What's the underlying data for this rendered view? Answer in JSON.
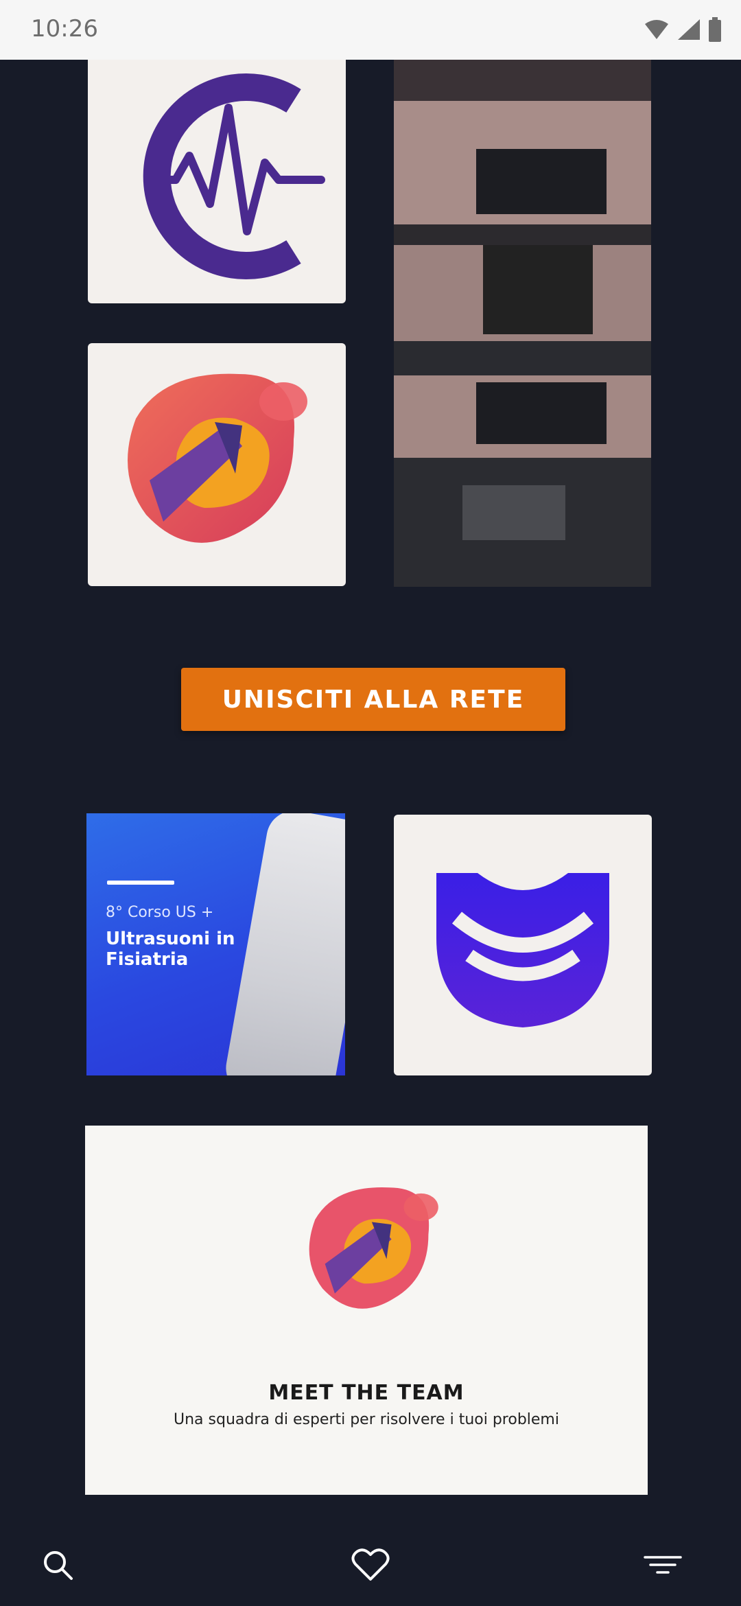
{
  "status_bar": {
    "time": "10:26",
    "icons": [
      "wifi-icon",
      "cellular-signal-icon",
      "battery-icon"
    ]
  },
  "tiles": {
    "logo_c": {
      "icon": "c-heartbeat-logo-icon"
    },
    "building": {
      "icon": "building-photo"
    },
    "blob": {
      "icon": "colorful-blob-logo-icon"
    },
    "course": {
      "edition": "8° Corso US +",
      "title": "Ultrasuoni in Fisiatria"
    },
    "us_logo": {
      "icon": "ultrasound-waves-logo-icon"
    }
  },
  "cta": {
    "label": "UNISCITI ALLA RETE"
  },
  "team": {
    "title": "MEET THE TEAM",
    "subtitle": "Una squadra di esperti per risolvere i tuoi problemi"
  },
  "bottom_nav": {
    "items": [
      {
        "icon": "search-icon"
      },
      {
        "icon": "heart-icon"
      },
      {
        "icon": "menu-icon"
      }
    ]
  },
  "colors": {
    "background": "#171b28",
    "accent_orange": "#e27110",
    "logo_purple": "#4a2a8f",
    "course_blue": "#2a48e0",
    "us_logo_blue": "#3a1fe6"
  }
}
